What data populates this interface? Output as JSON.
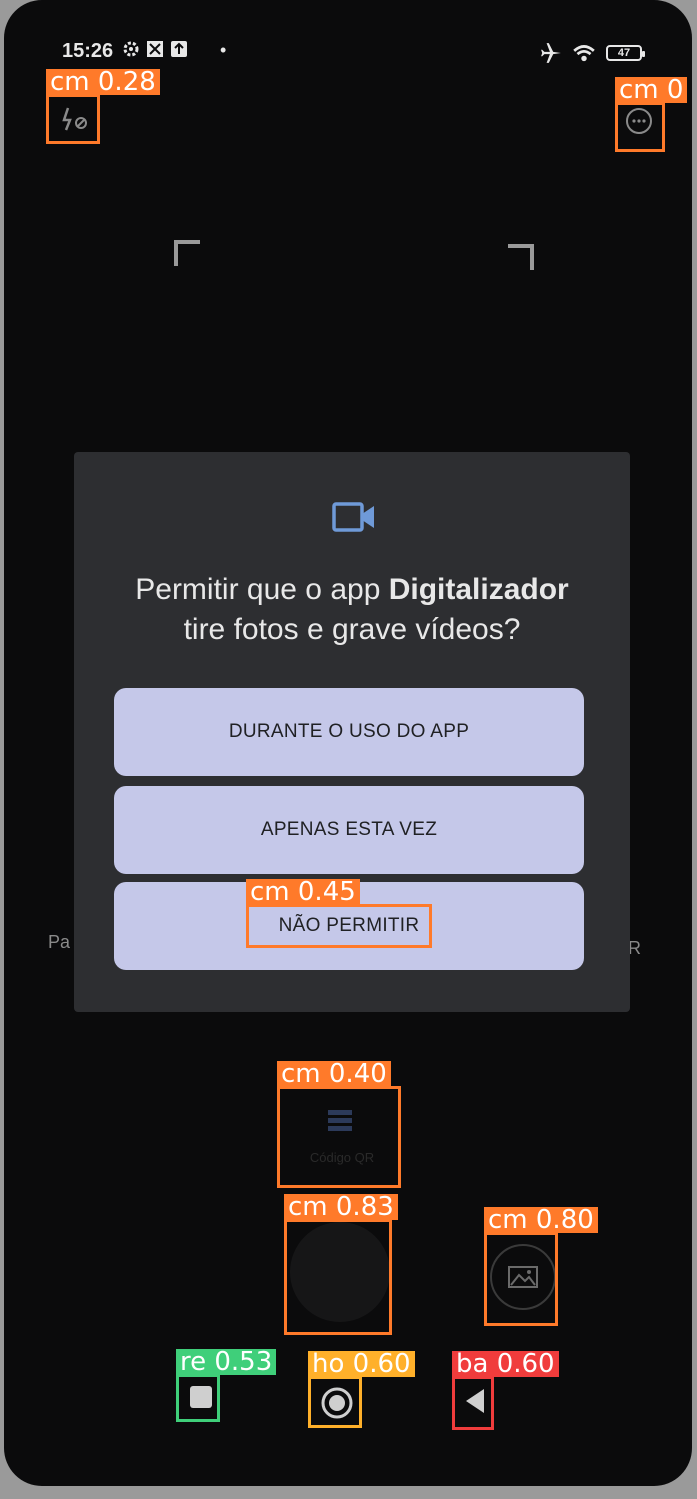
{
  "status_bar": {
    "time": "15:26",
    "battery_level": "47",
    "icons": [
      "gear-icon",
      "app-notification-icon",
      "upload-icon",
      "airplane-icon",
      "wifi-icon",
      "battery-icon"
    ]
  },
  "dialog": {
    "title_prefix": "Permitir que o app ",
    "app_name": "Digitalizador",
    "title_suffix": "tire fotos e grave vídeos?",
    "icon": "video-camera-icon",
    "buttons": {
      "while_using": "DURANTE O USO DO APP",
      "only_this_time": "APENAS ESTA VEZ",
      "deny": "NÃO PERMITIR"
    },
    "button_color": "#c5c8e9",
    "background_color": "#2d2e31"
  },
  "camera": {
    "left_label": "Pa",
    "right_label": "QR",
    "qr_text": "Código QR"
  },
  "detections": [
    {
      "label": "cm 0.28",
      "color": "#ff7a2a"
    },
    {
      "label": "cm 0",
      "color": "#ff7a2a"
    },
    {
      "label": "cm 0.45",
      "color": "#ff7a2a"
    },
    {
      "label": "cm 0.40",
      "color": "#ff7a2a"
    },
    {
      "label": "cm 0.83",
      "color": "#ff7a2a"
    },
    {
      "label": "cm 0.80",
      "color": "#ff7a2a"
    },
    {
      "label": "re 0.53",
      "color": "#3fcf7a"
    },
    {
      "label": "ho 0.60",
      "color": "#ffb02a"
    },
    {
      "label": "ba 0.60",
      "color": "#f03c3c"
    }
  ]
}
